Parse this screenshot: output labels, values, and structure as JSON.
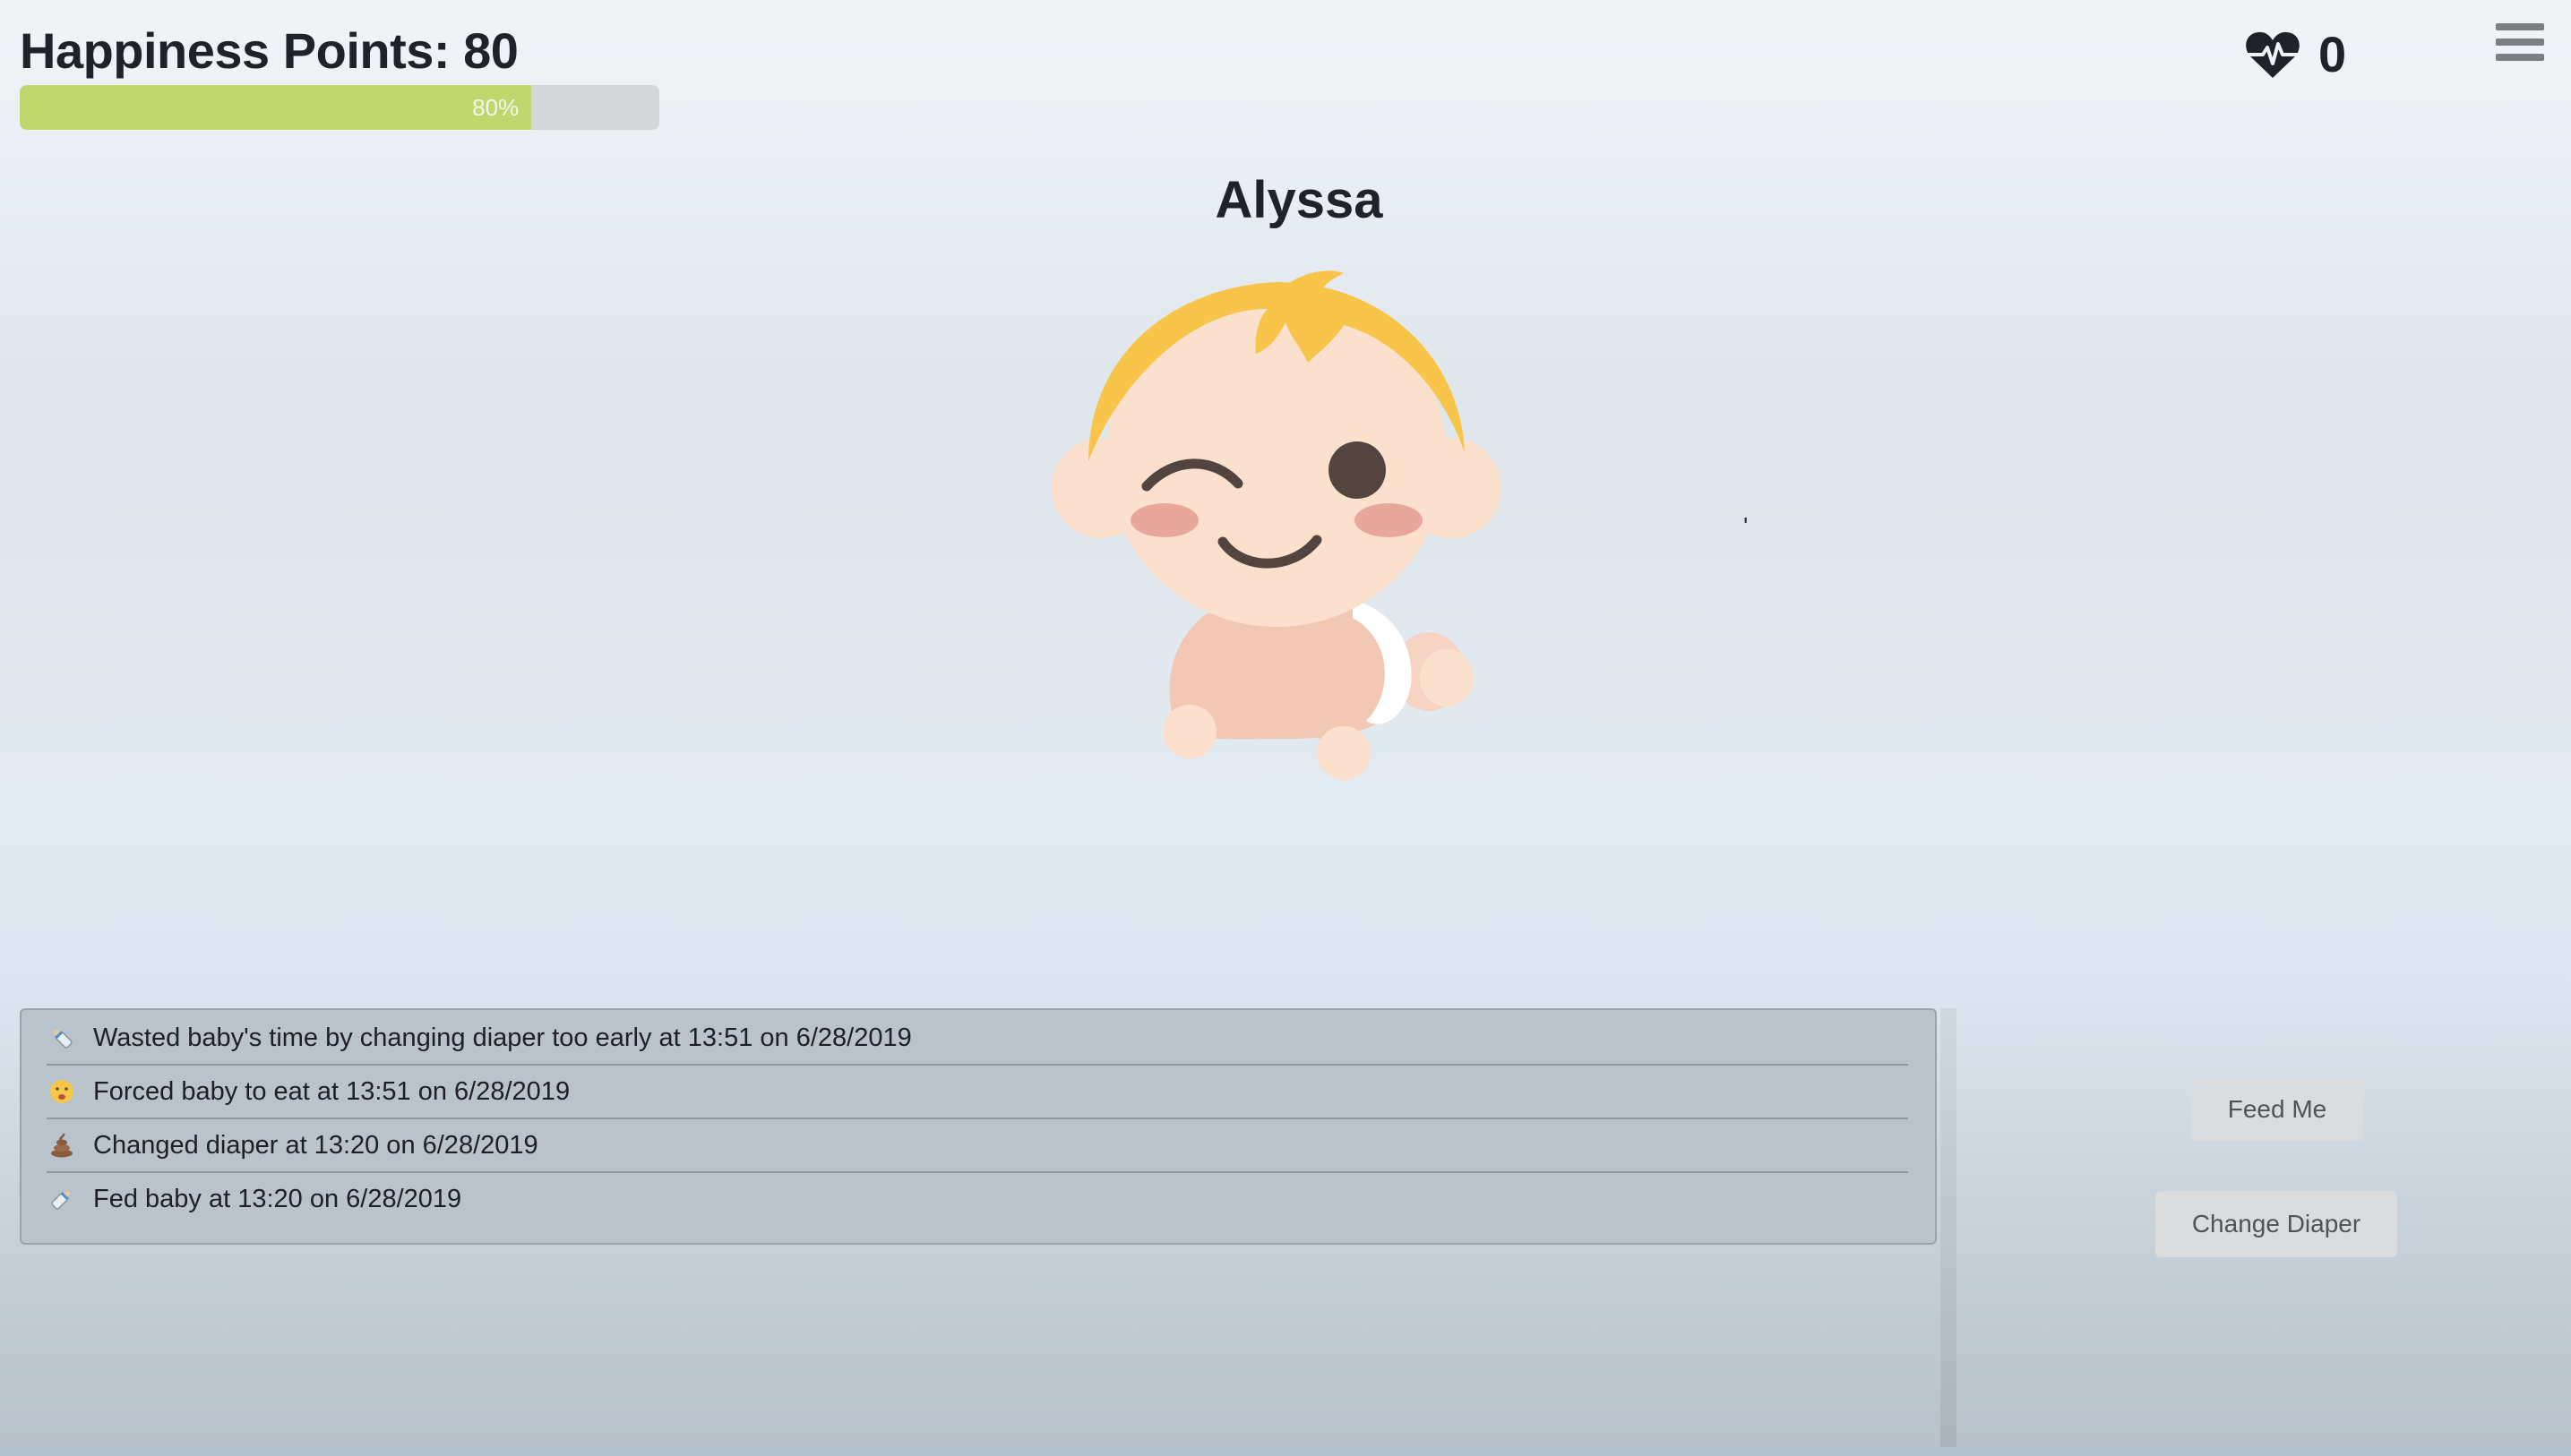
{
  "header": {
    "happiness_title": "Happiness Points: 80",
    "happiness_percent": 80,
    "progress_label": "80%",
    "hearts_icon": "heartbeat-icon",
    "hearts_count": "0",
    "menu_icon": "hamburger-menu-icon"
  },
  "baby": {
    "name": "Alyssa",
    "expression": "winking"
  },
  "stray_mark": "'",
  "log": {
    "entries": [
      {
        "icon": "baby-bottle-icon",
        "text": "Wasted baby's time by changing diaper too early at 13:51 on 6/28/2019"
      },
      {
        "icon": "sad-face-icon",
        "text": "Forced baby to eat at 13:51 on 6/28/2019"
      },
      {
        "icon": "poop-icon",
        "text": "Changed diaper at 13:20 on 6/28/2019"
      },
      {
        "icon": "baby-bottle-icon",
        "text": "Fed baby at 13:20 on 6/28/2019"
      }
    ]
  },
  "actions": {
    "feed_label": "Feed Me",
    "change_diaper_label": "Change Diaper"
  },
  "colors": {
    "progress_fill": "#bed86e",
    "progress_track": "#d3d7da",
    "hair": "#f8c54a",
    "skin": "#fbe1cd",
    "cheeks": "#e9a79c",
    "features": "#524540",
    "log_panel": "#b8c3cb"
  }
}
